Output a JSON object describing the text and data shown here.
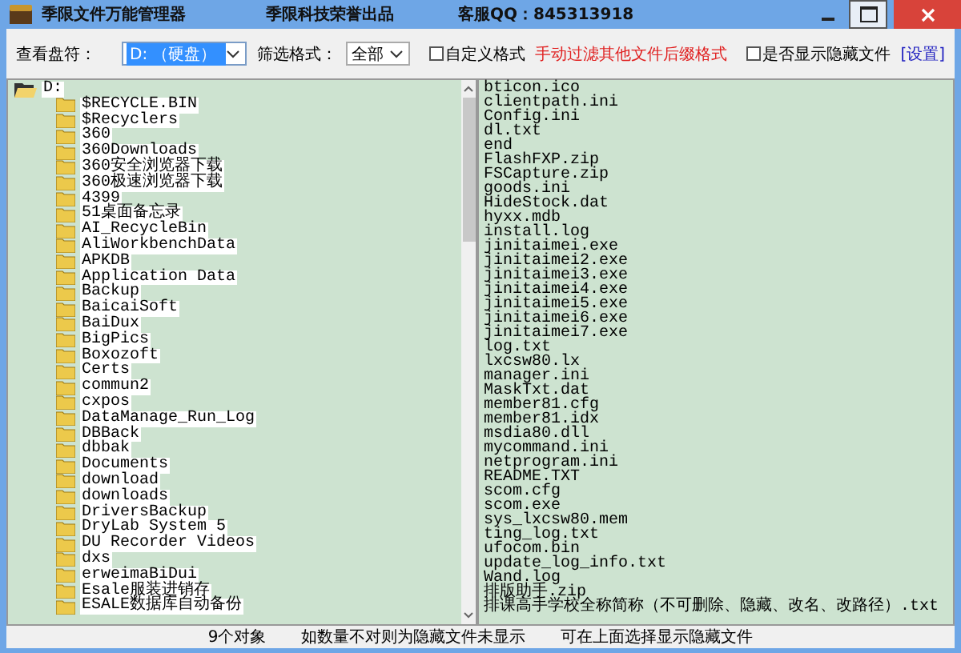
{
  "window": {
    "title": "季限文件万能管理器",
    "publisher": "季限科技荣誉出品",
    "support": "客服QQ：845313918"
  },
  "toolbar": {
    "drive_label": "查看盘符：",
    "drive_value": "D: （硬盘）",
    "filter_label": "筛选格式：",
    "filter_value": "全部",
    "custom_format": {
      "label": "自定义格式",
      "checked": false
    },
    "hint": "手动过滤其他文件后缀格式",
    "show_hidden": {
      "label": "是否显示隐藏文件",
      "checked": false
    },
    "settings_link": "[设置]"
  },
  "tree": {
    "label": "D:",
    "expanded": true,
    "children": [
      {
        "label": "$RECYCLE.BIN"
      },
      {
        "label": "$Recyclers"
      },
      {
        "label": "360"
      },
      {
        "label": "360Downloads"
      },
      {
        "label": "360安全浏览器下载"
      },
      {
        "label": "360极速浏览器下载"
      },
      {
        "label": "4399"
      },
      {
        "label": "51桌面备忘录"
      },
      {
        "label": "AI_RecycleBin"
      },
      {
        "label": "AliWorkbenchData"
      },
      {
        "label": "APKDB"
      },
      {
        "label": "Application Data"
      },
      {
        "label": "Backup"
      },
      {
        "label": "BaicaiSoft"
      },
      {
        "label": "BaiDux"
      },
      {
        "label": "BigPics"
      },
      {
        "label": "Boxozoft"
      },
      {
        "label": "Certs"
      },
      {
        "label": "commun2"
      },
      {
        "label": "cxpos"
      },
      {
        "label": "DataManage_Run_Log"
      },
      {
        "label": "DBBack"
      },
      {
        "label": "dbbak"
      },
      {
        "label": "Documents"
      },
      {
        "label": "download"
      },
      {
        "label": "downloads"
      },
      {
        "label": "DriversBackup"
      },
      {
        "label": "DryLab System 5"
      },
      {
        "label": "DU Recorder Videos"
      },
      {
        "label": "dxs"
      },
      {
        "label": "erweimaBiDui"
      },
      {
        "label": "Esale服装进销存"
      },
      {
        "label": "ESALE数据库自动备份"
      }
    ]
  },
  "files": [
    "bticon.ico",
    "clientpath.ini",
    "Config.ini",
    "dl.txt",
    "end",
    "FlashFXP.zip",
    "FSCapture.zip",
    "goods.ini",
    "HideStock.dat",
    "hyxx.mdb",
    "install.log",
    "jinitaimei.exe",
    "jinitaimei2.exe",
    "jinitaimei3.exe",
    "jinitaimei4.exe",
    "jinitaimei5.exe",
    "jinitaimei6.exe",
    "jinitaimei7.exe",
    "log.txt",
    "lxcsw80.lx",
    "manager.ini",
    "MaskTxt.dat",
    "member81.cfg",
    "member81.idx",
    "msdia80.dll",
    "mycommand.ini",
    "netprogram.ini",
    "README.TXT",
    "scom.cfg",
    "scom.exe",
    "sys_lxcsw80.mem",
    "ting_log.txt",
    "ufocom.bin",
    "update_log_info.txt",
    "Wand.log",
    "排版助手.zip",
    "排课高手学校全称简称（不可删除、隐藏、改名、改路径）.txt"
  ],
  "status_bar": [
    "9个对象",
    "如数量不对则为隐藏文件未显示",
    "可在上面选择显示隐藏文件"
  ]
}
